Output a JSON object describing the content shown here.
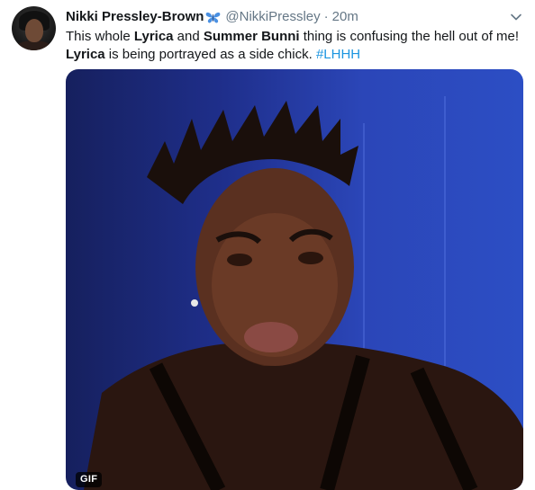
{
  "tweet": {
    "author_name": "Nikki Pressley-Brown",
    "author_handle": "@NikkiPressley",
    "separator": "·",
    "timestamp": "20m",
    "text": {
      "part1": "This whole ",
      "bold1": "Lyrica",
      "part2": " and ",
      "bold2": "Summer Bunni",
      "part3": " thing is confusing the hell out of me!",
      "bold3": "Lyrica",
      "part4": " is being portrayed as a side chick. ",
      "hashtag": "#LHHH"
    },
    "media_badge": "GIF",
    "icons": {
      "avatar": "avatar",
      "name_emoji": "butterfly-icon",
      "menu": "chevron-down-icon"
    },
    "colors": {
      "link": "#1b95e0",
      "secondary_text": "#657786",
      "butterfly": "#4a90e2"
    }
  }
}
